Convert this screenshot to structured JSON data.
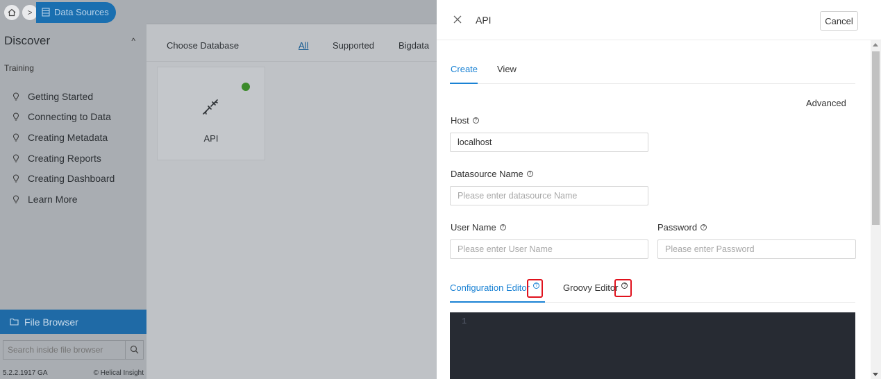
{
  "breadcrumb": {
    "current": "Data Sources"
  },
  "sidebar": {
    "discover_title": "Discover",
    "section_label": "Training",
    "items": [
      {
        "label": "Getting Started"
      },
      {
        "label": "Connecting to Data"
      },
      {
        "label": "Creating Metadata"
      },
      {
        "label": "Creating Reports"
      },
      {
        "label": "Creating Dashboard"
      },
      {
        "label": "Learn More"
      }
    ],
    "file_browser_label": "File Browser",
    "search_placeholder": "Search inside file browser",
    "version": "5.2.2.1917 GA",
    "brand": "© Helical Insight"
  },
  "main": {
    "choose_label": "Choose Database",
    "tabs": [
      "All",
      "Supported",
      "Bigdata"
    ],
    "card": {
      "label": "API",
      "status": "supported"
    }
  },
  "panel": {
    "title": "API",
    "cancel_label": "Cancel",
    "tabs": {
      "create": "Create",
      "view": "View"
    },
    "advanced_label": "Advanced",
    "host": {
      "label": "Host",
      "value": "localhost"
    },
    "datasource_name": {
      "label": "Datasource Name",
      "placeholder": "Please enter datasource Name"
    },
    "user_name": {
      "label": "User Name",
      "placeholder": "Please enter User Name"
    },
    "password": {
      "label": "Password",
      "placeholder": "Please enter Password"
    },
    "editor_tabs": {
      "config": "Configuration Editor",
      "groovy": "Groovy Editor"
    },
    "editor_line": "1"
  },
  "colors": {
    "accent": "#1a82d4",
    "highlight": "#e0121d",
    "editor_bg": "#272b33"
  },
  "icons": {
    "home": "home-icon",
    "close": "close-icon",
    "plug": "plug-icon",
    "help": "help-circle-icon"
  }
}
